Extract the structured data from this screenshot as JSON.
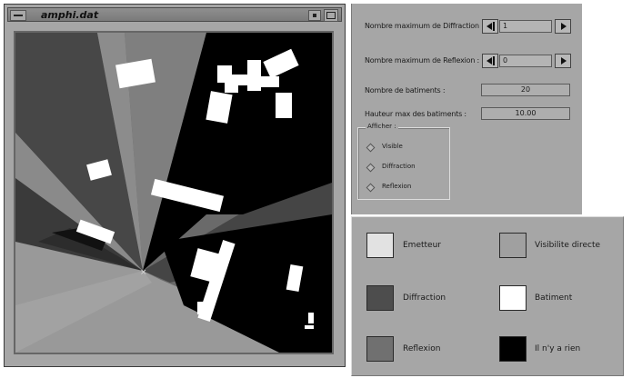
{
  "window": {
    "title": "amphi.dat",
    "menu_icon": "menu-bar-icon",
    "minimize_icon": "minimize-icon",
    "maximize_icon": "maximize-icon"
  },
  "scene": {
    "colors": {
      "emitter_light": "#e4e4e4",
      "direct_visibility": "#9c9c9c",
      "diffraction": "#4f4f4f",
      "reflection": "#6e6e6e",
      "building": "#ffffff",
      "nothing": "#000000"
    },
    "emitter_marker": "×"
  },
  "params": {
    "max_diffraction": {
      "label": "Nombre maximum de Diffraction :",
      "value": "1"
    },
    "max_reflection": {
      "label": "Nombre maximum de Reflexion :",
      "value": "0"
    },
    "nb_buildings": {
      "label": "Nombre de batiments :",
      "value": "20"
    },
    "max_height": {
      "label": "Hauteur max des batiments :",
      "value": "10.00"
    },
    "display": {
      "title": "Afficher :",
      "options": [
        "Visible",
        "Diffraction",
        "Reflexion"
      ]
    }
  },
  "legend": {
    "items": [
      {
        "label": "Emetteur",
        "color": "#e2e2e2"
      },
      {
        "label": "Visibilite directe",
        "color": "#a0a0a0"
      },
      {
        "label": "Diffraction",
        "color": "#4d4d4d"
      },
      {
        "label": "Batiment",
        "color": "#ffffff"
      },
      {
        "label": "Reflexion",
        "color": "#707070"
      },
      {
        "label": "Il n'y a rien",
        "color": "#000000"
      }
    ]
  }
}
